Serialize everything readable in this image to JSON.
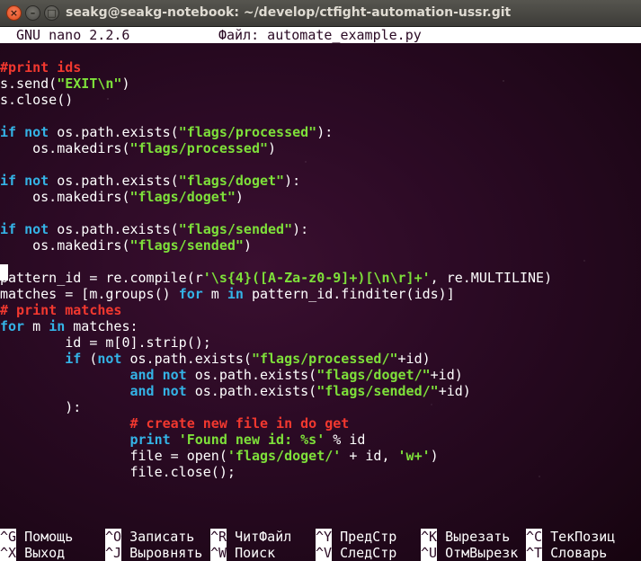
{
  "window": {
    "title": "seakg@seakg-notebook: ~/develop/ctfight-automation-ussr.git",
    "close_glyph": "×",
    "minimize_glyph": "–",
    "maximize_glyph": "□"
  },
  "editor": {
    "version": "GNU nano 2.2.6",
    "file_label": "Файл: automate_example.py"
  },
  "code": {
    "l1_comment": "#print ids",
    "l2_a": "s.send(",
    "l2_str": "\"EXIT\\n\"",
    "l2_b": ")",
    "l3": "s.close()",
    "l5_if": "if",
    "l5_not": "not",
    "l5_a": " os.path.exists(",
    "l5_str": "\"flags/processed\"",
    "l5_b": "):",
    "l6_a": "    os.makedirs(",
    "l6_str": "\"flags/processed\"",
    "l6_b": ")",
    "l8_if": "if",
    "l8_not": "not",
    "l8_a": " os.path.exists(",
    "l8_str": "\"flags/doget\"",
    "l8_b": "):",
    "l9_a": "    os.makedirs(",
    "l9_str": "\"flags/doget\"",
    "l9_b": ")",
    "l11_if": "if",
    "l11_not": "not",
    "l11_a": " os.path.exists(",
    "l11_str": "\"flags/sended\"",
    "l11_b": "):",
    "l12_a": "    os.makedirs(",
    "l12_str": "\"flags/sended\"",
    "l12_b": ")",
    "l14_a": "pattern_id = re.compile(r",
    "l14_str": "'\\s{4}([A-Za-z0-9]+)[\\n\\r]+'",
    "l14_b": ", re.MULTILINE)",
    "l15_a": "matches = [m.groups() ",
    "l15_for": "for",
    "l15_b": " m ",
    "l15_in": "in",
    "l15_c": " pattern_id.finditer(ids)]",
    "l16_comment": "# print matches",
    "l17_for": "for",
    "l17_a": " m ",
    "l17_in": "in",
    "l17_b": " matches:",
    "l18": "        id = m[0].strip();",
    "l19_indent": "        ",
    "l19_if": "if",
    "l19_a": " (",
    "l19_not": "not",
    "l19_b": " os.path.exists(",
    "l19_str": "\"flags/processed/\"",
    "l19_c": "+id)",
    "l20_indent": "                ",
    "l20_and": "and",
    "l20_sp": " ",
    "l20_not": "not",
    "l20_a": " os.path.exists(",
    "l20_str": "\"flags/doget/\"",
    "l20_b": "+id)",
    "l21_indent": "                ",
    "l21_and": "and",
    "l21_sp": " ",
    "l21_not": "not",
    "l21_a": " os.path.exists(",
    "l21_str": "\"flags/sended/\"",
    "l21_b": "+id)",
    "l22": "        ):",
    "l24_indent": "                ",
    "l24_comment": "# create new file in do get",
    "l25_indent": "                ",
    "l25_print": "print",
    "l25_sp": " ",
    "l25_str": "'Found new id: %s'",
    "l25_b": " % id",
    "l26_a": "                file = open(",
    "l26_str1": "'flags/doget/'",
    "l26_b": " + id, ",
    "l26_str2": "'w+'",
    "l26_c": ")",
    "l27": "                file.close();"
  },
  "shortcuts": {
    "row1": [
      {
        "key": "^G",
        "label": "Помощь"
      },
      {
        "key": "^O",
        "label": "Записать"
      },
      {
        "key": "^R",
        "label": "ЧитФайл"
      },
      {
        "key": "^Y",
        "label": "ПредСтр"
      },
      {
        "key": "^K",
        "label": "Вырезать"
      },
      {
        "key": "^C",
        "label": "ТекПозиц"
      }
    ],
    "row2": [
      {
        "key": "^X",
        "label": "Выход"
      },
      {
        "key": "^J",
        "label": "Выровнять"
      },
      {
        "key": "^W",
        "label": "Поиск"
      },
      {
        "key": "^V",
        "label": "СледСтр"
      },
      {
        "key": "^U",
        "label": "ОтмВырезк"
      },
      {
        "key": "^T",
        "label": "Словарь"
      }
    ]
  },
  "colors": {
    "keyword": "#34b3e6",
    "string": "#7ee03a",
    "comment": "#f2382f",
    "background": "#2b0a24",
    "close_button": "#e95420"
  }
}
